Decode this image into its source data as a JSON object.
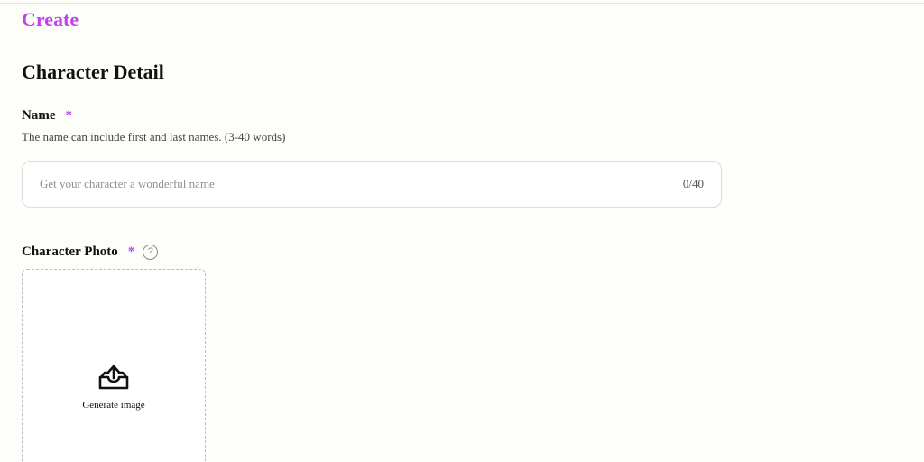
{
  "header": {
    "brand": "Create"
  },
  "section": {
    "title": "Character Detail"
  },
  "name_field": {
    "label": "Name",
    "required_mark": "*",
    "hint": "The name can include first and last names. (3-40 words)",
    "value": "",
    "placeholder": "Get your character a wonderful name",
    "counter": "0/40"
  },
  "photo_field": {
    "label": "Character Photo",
    "required_mark": "*",
    "help_icon": "?",
    "upload_icon": "upload-tray-icon",
    "upload_label": "Generate image"
  },
  "colors": {
    "brand": "#c23ef0",
    "required": "#b04ce8",
    "background": "#fdfdf9"
  }
}
